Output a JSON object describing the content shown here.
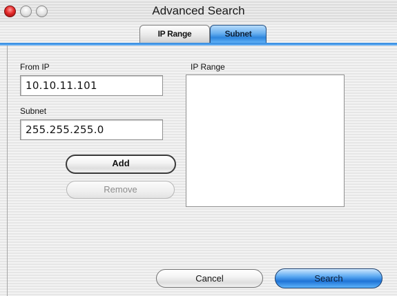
{
  "window": {
    "title": "Advanced Search"
  },
  "tabs": [
    {
      "label": "IP Range",
      "selected": false
    },
    {
      "label": "Subnet",
      "selected": true
    }
  ],
  "form": {
    "from_ip_label": "From IP",
    "from_ip_value": "10.10.11.101",
    "subnet_label": "Subnet",
    "subnet_value": "255.255.255.0",
    "ip_range_label": "IP Range",
    "ip_range_items": []
  },
  "buttons": {
    "add": "Add",
    "remove": "Remove",
    "cancel": "Cancel",
    "search": "Search"
  },
  "colors": {
    "accent_blue": "#2e86dd",
    "close_red": "#e52b2b"
  }
}
